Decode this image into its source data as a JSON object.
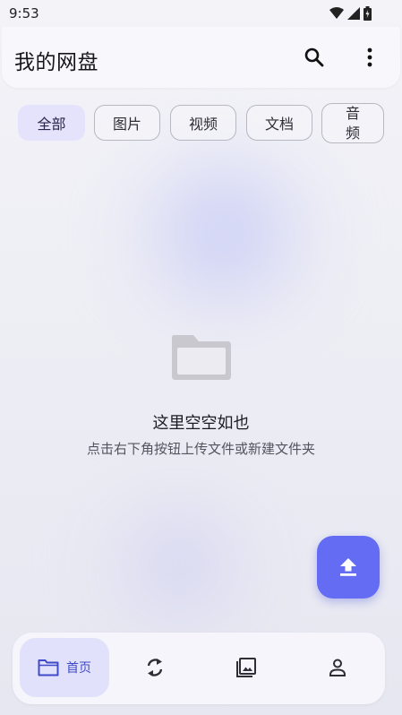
{
  "status": {
    "time": "9:53"
  },
  "appbar": {
    "title": "我的网盘"
  },
  "filters": {
    "all": "全部",
    "images": "图片",
    "videos": "视频",
    "docs": "文档",
    "audio": "音\n频"
  },
  "empty": {
    "title": "这里空空如也",
    "subtitle": "点击右下角按钮上传文件或新建文件夹"
  },
  "nav": {
    "home": "首页"
  },
  "colors": {
    "accent": "#646cf4",
    "accent_soft": "#e2e1fb",
    "nav_active_text": "#3e4ac8"
  },
  "icons": [
    "search-icon",
    "more-vert-icon",
    "folder-icon",
    "upload-icon",
    "sync-icon",
    "gallery-icon",
    "person-icon"
  ]
}
